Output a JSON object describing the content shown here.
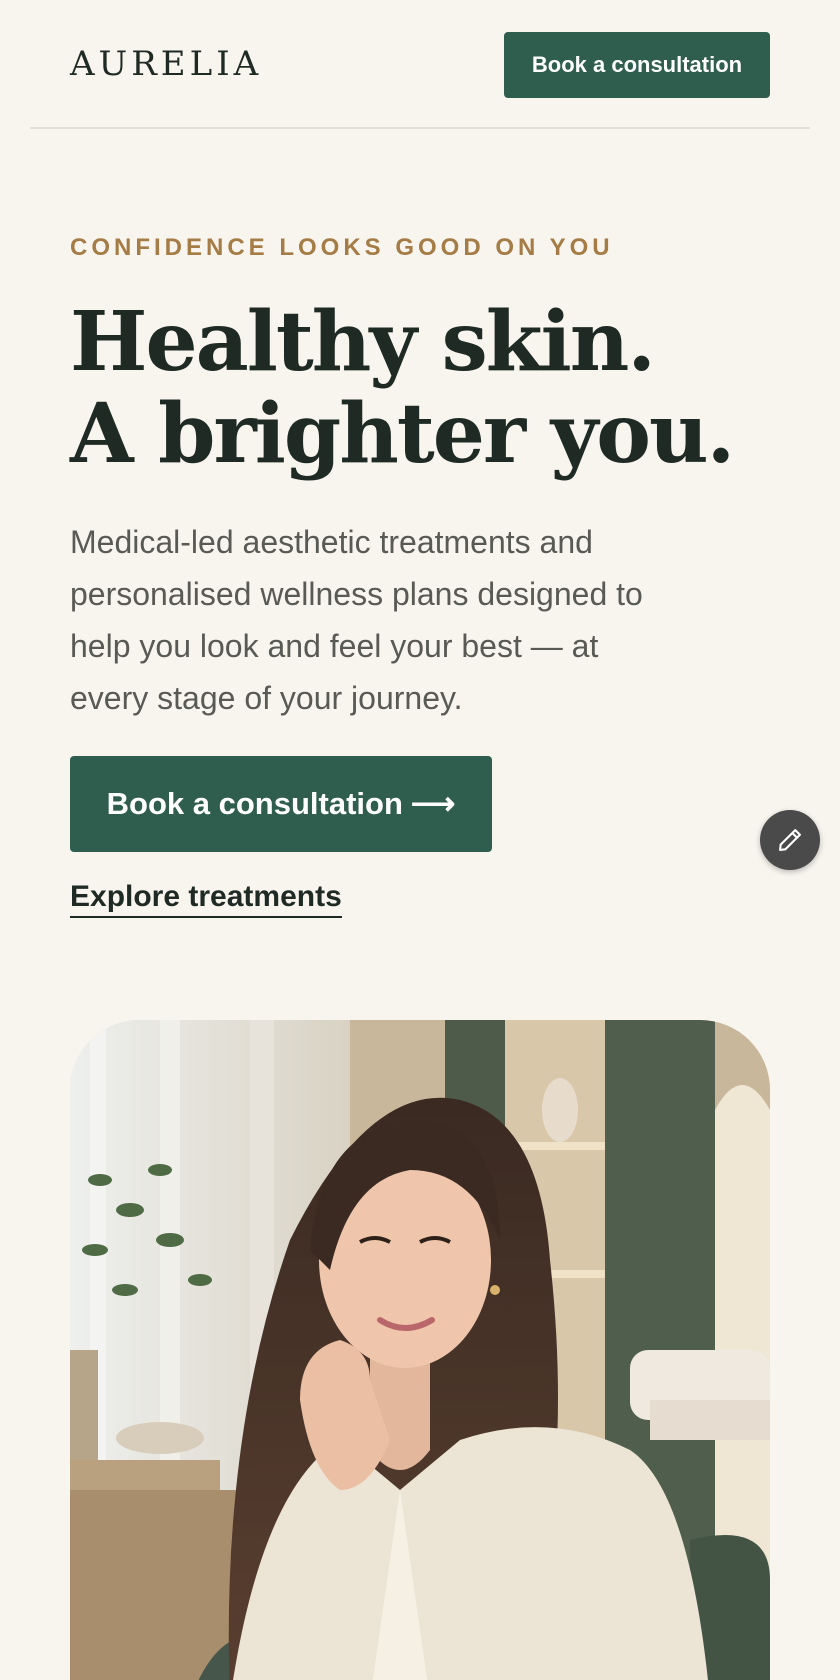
{
  "header": {
    "logo": "AURELIA",
    "cta_label": "Book a consultation"
  },
  "hero": {
    "eyebrow": "CONFIDENCE LOOKS GOOD ON YOU",
    "headline_line1": "Healthy skin.",
    "headline_line2": "A brighter you.",
    "body": "Medical-led aesthetic treatments and personalised wellness plans designed to help you look and feel your best — at every stage of your journey.",
    "primary_cta_label": "Book a consultation",
    "primary_cta_arrow": "⟶",
    "secondary_link": "Explore treatments"
  },
  "fab": {
    "icon": "pencil-icon"
  },
  "colors": {
    "background": "#f8f5ef",
    "brand_green": "#305e4e",
    "accent_gold": "#a57c45",
    "text_dark": "#1f2a24",
    "text_muted": "#5a5a55"
  }
}
